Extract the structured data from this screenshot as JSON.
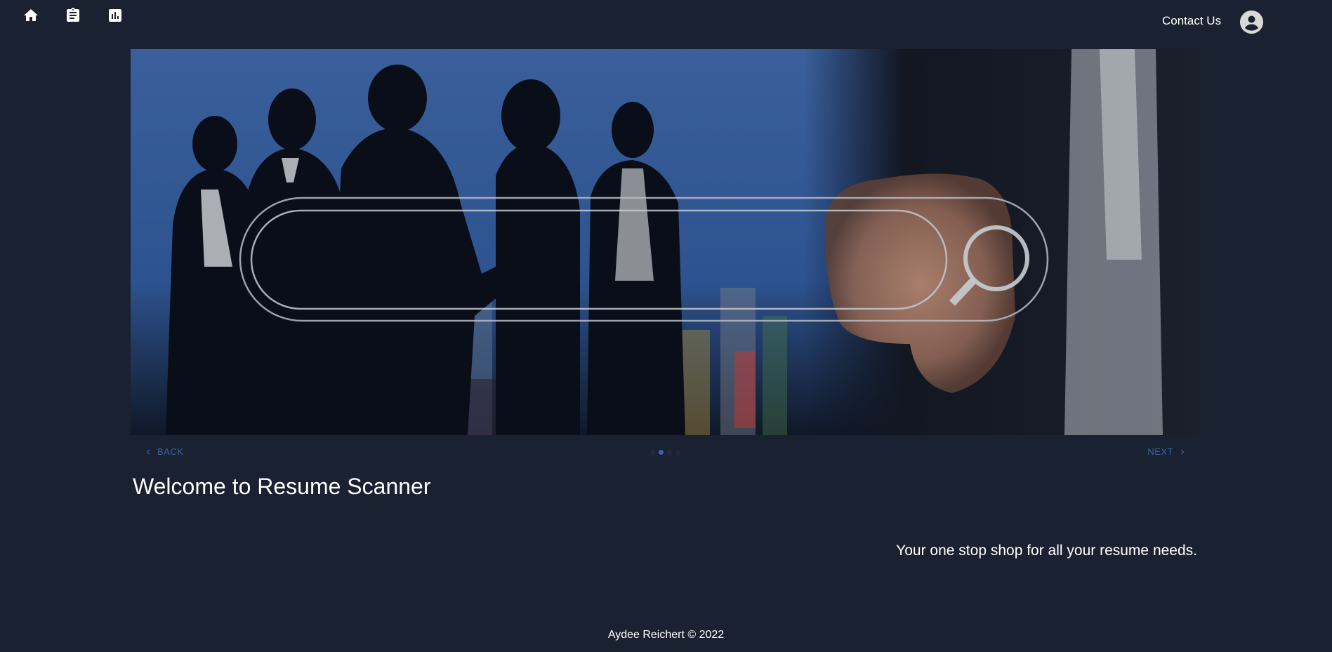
{
  "nav": {
    "icons": [
      "home-icon",
      "clipboard-icon",
      "bar-chart-icon"
    ],
    "contact_label": "Contact Us",
    "avatar_icon": "account-circle-icon"
  },
  "carousel": {
    "back_label": "BACK",
    "next_label": "NEXT",
    "steps": 4,
    "active_step": 2,
    "accent_color": "#3d63a8"
  },
  "main": {
    "title": "Welcome to Resume Scanner",
    "tagline": "Your one stop shop for all your resume needs."
  },
  "footer": {
    "text": "Aydee Reichert © 2022"
  },
  "colors": {
    "background": "#1a2131",
    "text": "#ffffff"
  }
}
